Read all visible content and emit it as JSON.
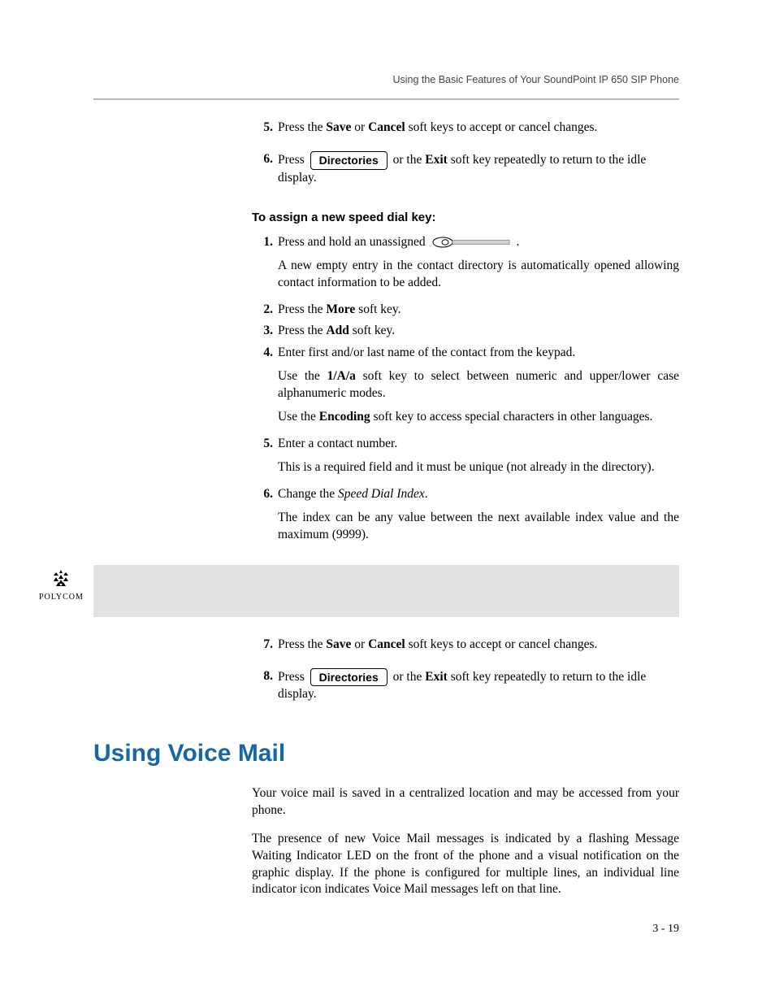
{
  "running_head": "Using the Basic Features of Your SoundPoint IP 650 SIP Phone",
  "steps_a": {
    "5": {
      "pre": "Press the ",
      "b1": "Save",
      "mid1": " or ",
      "b2": "Cancel",
      "post": " soft keys to accept or cancel changes."
    },
    "6": {
      "pre": "Press ",
      "key": "Directories",
      "mid": " or the ",
      "b1": "Exit",
      "post": " soft key repeatedly to return to the idle display."
    }
  },
  "subhead": "To assign a new speed dial key:",
  "steps_b": {
    "1": {
      "text": "Press and hold an unassigned ",
      "punct": ".",
      "follow": "A new empty entry in the contact directory is automatically opened allowing contact information to be added."
    },
    "2": {
      "pre": "Press the ",
      "b1": "More",
      "post": " soft key."
    },
    "3": {
      "pre": "Press the ",
      "b1": "Add",
      "post": " soft key."
    },
    "4": {
      "text": "Enter first and/or last name of the contact from the keypad.",
      "f1_pre": "Use the ",
      "f1_b": "1/A/a",
      "f1_post": " soft key to select between numeric and upper/lower case alphanumeric modes.",
      "f2_pre": "Use the ",
      "f2_b": "Encoding",
      "f2_post": " soft key to access special characters in other languages."
    },
    "5": {
      "text": "Enter a contact number.",
      "follow": "This is a required field and it must be unique (not already in the directory)."
    },
    "6": {
      "pre": "Change the ",
      "it": "Speed Dial Index",
      "post": ".",
      "follow": "The index can be any value between the next available index value and the maximum (9999)."
    },
    "7": {
      "pre": "Press the ",
      "b1": "Save",
      "mid1": " or ",
      "b2": "Cancel",
      "post": " soft keys to accept or cancel changes."
    },
    "8": {
      "pre": "Press ",
      "key": "Directories",
      "mid": " or the ",
      "b1": "Exit",
      "post": " soft key repeatedly to return to the idle display."
    }
  },
  "logo_text": "POLYCOM",
  "h1": "Using Voice Mail",
  "p1": "Your voice mail is saved in a centralized location and may be accessed from your phone.",
  "p2": "The presence of new Voice Mail messages is indicated by a flashing Message Waiting Indicator LED on the front of the phone and a visual notification on the graphic display. If the phone is configured for multiple lines, an individual line indicator icon indicates Voice Mail messages left on that line.",
  "page_num": "3 - 19"
}
